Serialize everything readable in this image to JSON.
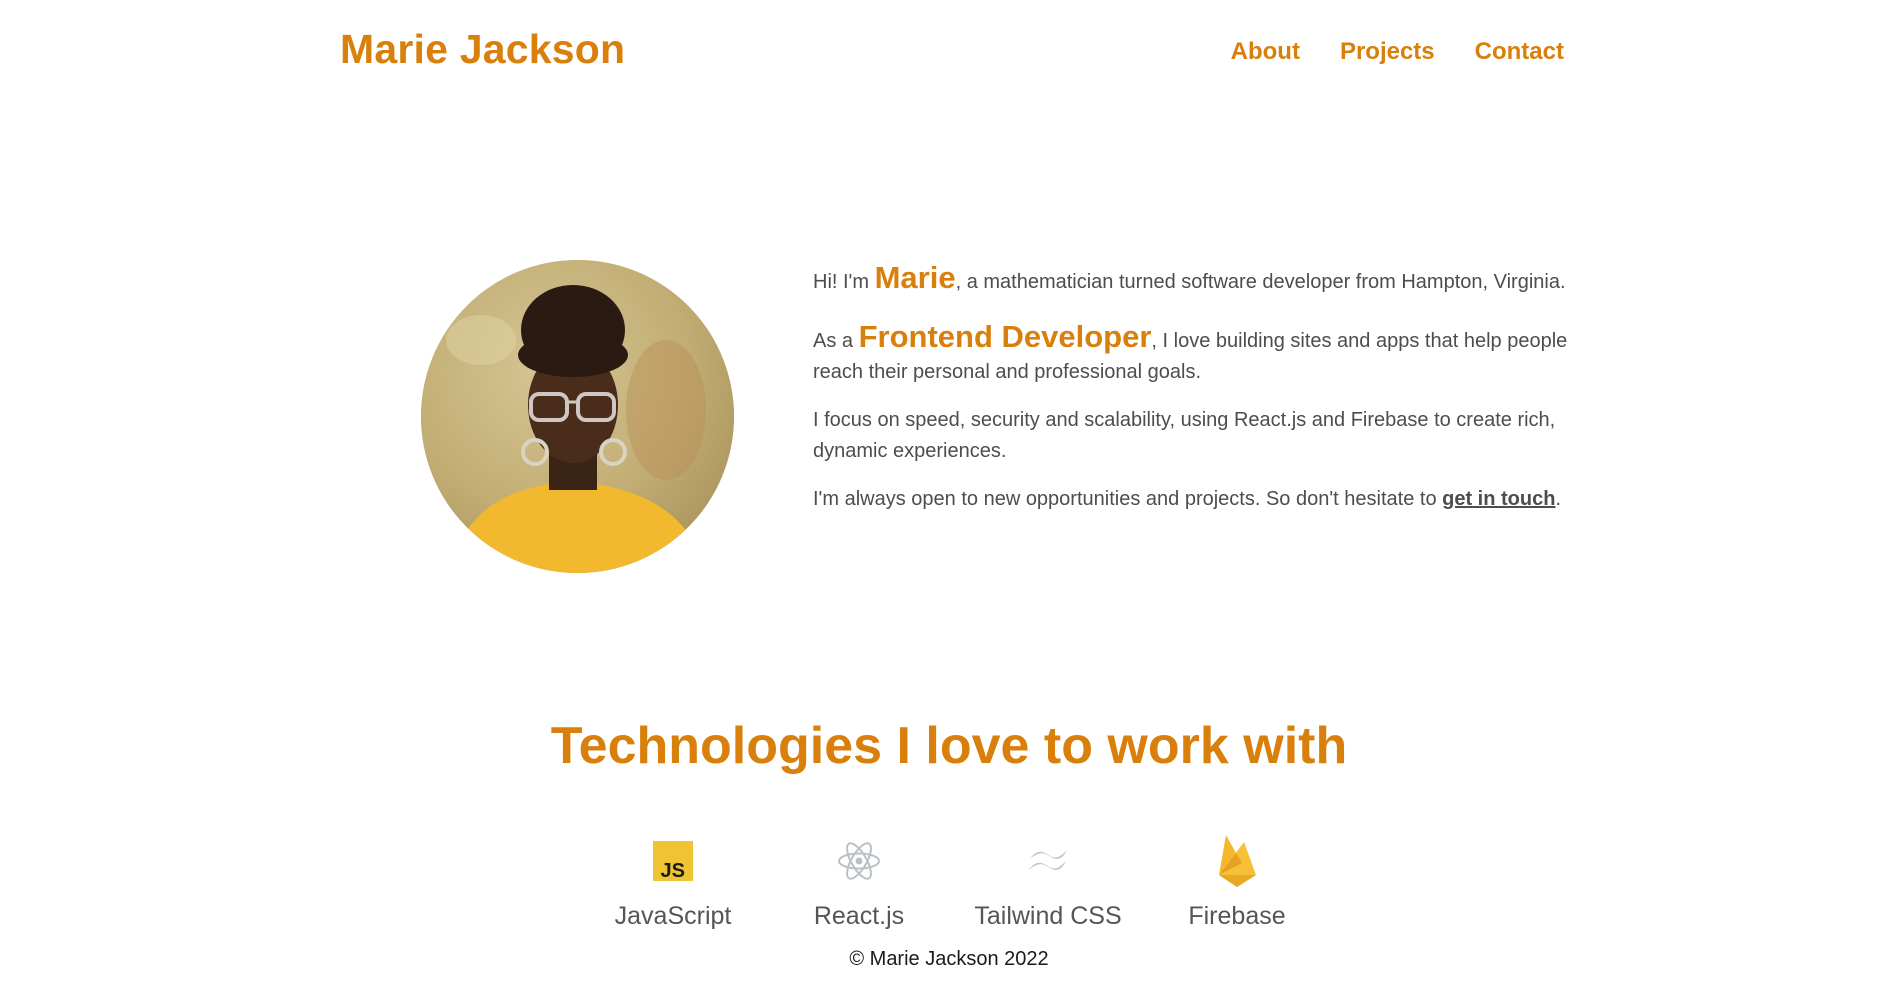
{
  "header": {
    "brand": "Marie Jackson",
    "nav": [
      {
        "label": "About"
      },
      {
        "label": "Projects"
      },
      {
        "label": "Contact"
      }
    ]
  },
  "bio": {
    "p1_before": "Hi! I'm ",
    "p1_name": "Marie",
    "p1_after": ", a mathematician turned software developer from Hampton, Virginia.",
    "p2_before": "As a ",
    "p2_role": "Frontend Developer",
    "p2_after": ", I love building sites and apps that help people reach their personal and professional goals.",
    "p3": "I focus on speed, security and scalability, using React.js and Firebase to create rich, dynamic experiences.",
    "p4_before": "I'm always open to new opportunities and projects. So don't hesitate to ",
    "p4_link": "get in touch",
    "p4_after": "."
  },
  "technologies": {
    "heading": "Technologies I love to work with",
    "items": [
      {
        "label": "JavaScript",
        "icon": "javascript-icon"
      },
      {
        "label": "React.js",
        "icon": "react-icon"
      },
      {
        "label": "Tailwind CSS",
        "icon": "tailwind-icon"
      },
      {
        "label": "Firebase",
        "icon": "firebase-icon"
      }
    ]
  },
  "footer": {
    "copyright": "© Marie Jackson 2022"
  },
  "colors": {
    "accent": "#d97f0b",
    "text": "#4d4d4d"
  }
}
